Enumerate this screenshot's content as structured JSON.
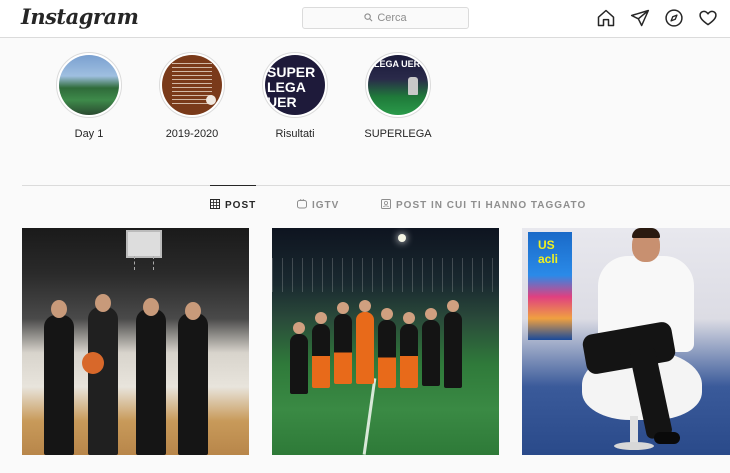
{
  "header": {
    "logo_text": "Instagram",
    "search_placeholder": "Cerca",
    "icons": [
      "home-icon",
      "direct-icon",
      "explore-icon",
      "activity-icon"
    ]
  },
  "highlights": [
    {
      "label": "Day 1"
    },
    {
      "label": "2019-2020"
    },
    {
      "label": "Risultati",
      "cover_text": "SUPER LEGA UER"
    },
    {
      "label": "SUPERLEGA",
      "cover_text": "LEGA UER"
    }
  ],
  "tabs": [
    {
      "label": "POST",
      "icon": "grid-icon",
      "active": true
    },
    {
      "label": "IGTV",
      "icon": "igtv-icon",
      "active": false
    },
    {
      "label": "POST IN CUI TI HANNO TAGGATO",
      "icon": "tagged-icon",
      "active": false
    }
  ],
  "posts": [
    {
      "subject": "basketball"
    },
    {
      "subject": "football-team"
    },
    {
      "subject": "tv-studio",
      "screen_text": "US acli"
    }
  ],
  "colors": {
    "text": "#262626",
    "muted": "#8e8e8e",
    "border": "#dbdbdb",
    "background": "#fafafa"
  }
}
